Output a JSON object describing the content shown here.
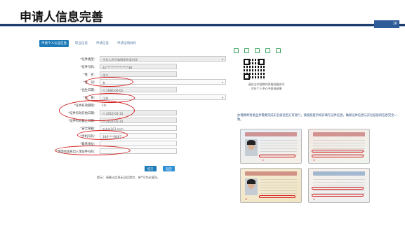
{
  "slide": {
    "title": "申请人信息完善",
    "page_number": "16"
  },
  "tabs": [
    {
      "label": "申请个人认证信息",
      "active": true
    },
    {
      "label": "职业信息",
      "active": false
    },
    {
      "label": "申请信息",
      "active": false
    },
    {
      "label": "申请证明材料",
      "active": false
    }
  ],
  "form": {
    "rows": [
      {
        "label": "*证件类型：",
        "value": "中华人民共和国居民身份证",
        "dropdown": true,
        "grey": true
      },
      {
        "label": "*证件号码：",
        "value": "31***************38",
        "grey": true
      },
      {
        "label": "*姓　名：",
        "value": "张三",
        "grey": true
      },
      {
        "label": "*性　别：",
        "value": "女",
        "dropdown": true,
        "grey": false
      },
      {
        "label": "*出生日期：",
        "value": "1986-06-01",
        "grey": true
      },
      {
        "label": "*民　族：",
        "value": "汉族",
        "dropdown": true,
        "grey": false
      },
      {
        "label": "*证件有效期限：",
        "value": "5年",
        "grey": true
      },
      {
        "label": "*证件有效开始日期：",
        "value": "2016-05-10",
        "grey": true
      },
      {
        "label": "*证件有效截止日期：",
        "value": "2021-05-10",
        "grey": true
      },
      {
        "label": "*安全邮箱：",
        "value": "zxh@163.com",
        "grey": false
      },
      {
        "label": "*手机号码：",
        "value": "186****8887",
        "grey": false
      },
      {
        "label": "*联系地址：",
        "value": "",
        "grey": false
      },
      {
        "label": "*港澳台居民出入境证件号码：",
        "value": "",
        "grey": false
      }
    ],
    "submit_label": "提交",
    "back_label": "返回",
    "hint": "提示：请确认信息无误后提交，带*号为必填项。"
  },
  "right": {
    "qr_caption": "请关注中国教师资格网服务号\n可在个人中心中查询结果",
    "notice": "办理教师资格业务需要完成实名核验后方可进行，请按照提示如实填写证件信息，确保证件信息与实名核验的信息完全一致。",
    "cards": [
      {
        "name": "id-card-front-sample"
      },
      {
        "name": "id-card-back-sample"
      },
      {
        "name": "residence-permit-sample"
      },
      {
        "name": "travel-permit-sample"
      }
    ]
  },
  "colors": {
    "accent": "#1d7bb8",
    "highlight": "#d42020",
    "title_rule": "#1f3d6b"
  }
}
